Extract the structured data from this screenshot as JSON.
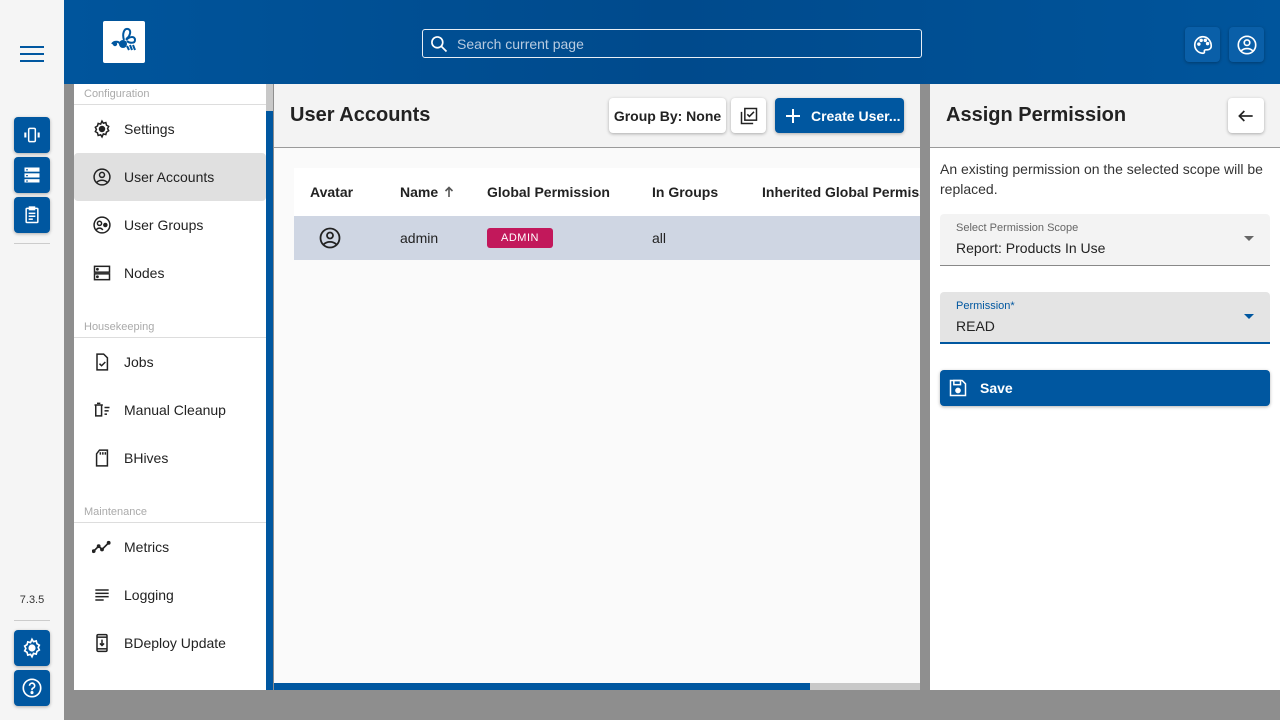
{
  "app": {
    "version": "7.3.5",
    "logo": "bee-logo-icon"
  },
  "header": {
    "search": {
      "placeholder": "Search current page",
      "value": ""
    },
    "buttons": [
      {
        "name": "theme-button",
        "icon": "palette-icon"
      },
      {
        "name": "user-button",
        "icon": "account-circle-icon"
      }
    ]
  },
  "rail": {
    "top_buttons": [
      {
        "name": "instances-button",
        "icon": "vibration-icon"
      },
      {
        "name": "servers-button",
        "icon": "dns-icon"
      },
      {
        "name": "reports-button",
        "icon": "assignment-icon"
      }
    ],
    "bottom_buttons": [
      {
        "name": "admin-settings-button",
        "icon": "settings-icon"
      },
      {
        "name": "help-button",
        "icon": "help-icon"
      }
    ]
  },
  "menu": {
    "sections": [
      {
        "title": "Configuration",
        "items": [
          {
            "label": "Settings",
            "icon": "settings-icon"
          },
          {
            "label": "User Accounts",
            "icon": "account-circle-icon",
            "active": true
          },
          {
            "label": "User Groups",
            "icon": "group-icon"
          },
          {
            "label": "Nodes",
            "icon": "nodes-icon"
          }
        ]
      },
      {
        "title": "Housekeeping",
        "items": [
          {
            "label": "Jobs",
            "icon": "task-icon"
          },
          {
            "label": "Manual Cleanup",
            "icon": "delete-sweep-icon"
          },
          {
            "label": "BHives",
            "icon": "sd-card-icon"
          }
        ]
      },
      {
        "title": "Maintenance",
        "items": [
          {
            "label": "Metrics",
            "icon": "timeline-icon"
          },
          {
            "label": "Logging",
            "icon": "notes-icon"
          },
          {
            "label": "BDeploy Update",
            "icon": "system-update-icon"
          }
        ]
      }
    ]
  },
  "main": {
    "title": "User Accounts",
    "group_by_label": "Group By: None",
    "create_label": "Create User...",
    "table": {
      "columns": [
        "Avatar",
        "Name",
        "Global Permission",
        "In Groups",
        "Inherited Global Permissi"
      ],
      "sort": {
        "column": "Name",
        "direction": "asc"
      },
      "rows": [
        {
          "avatar": "account-circle-icon",
          "name": "admin",
          "global_permission": "ADMIN",
          "in_groups": "all",
          "inherited": ""
        }
      ]
    },
    "hscroll_fraction": 0.83
  },
  "panel": {
    "title": "Assign Permission",
    "info": "An existing permission on the selected scope will be replaced.",
    "scope_field": {
      "label": "Select Permission Scope",
      "value": "Report: Products In Use"
    },
    "permission_field": {
      "label": "Permission*",
      "value": "READ"
    },
    "save_label": "Save"
  },
  "colors": {
    "primary": "#0057a0",
    "admin_badge": "#c2185b",
    "selected_row": "#cfd6e3"
  }
}
